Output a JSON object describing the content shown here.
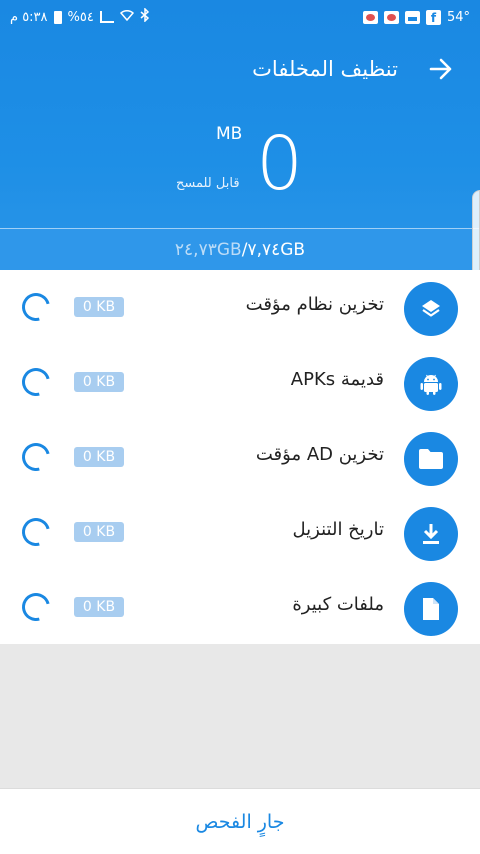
{
  "status_bar": {
    "time": "٥:٣٨ م",
    "battery_percent": "%٥٤",
    "temperature": "54°"
  },
  "header": {
    "title": "تنظيف المخلفات",
    "back_icon": "arrow-right-icon",
    "size_value": "0",
    "size_unit": "MB",
    "cleanable_label": "قابل للمسح"
  },
  "storage": {
    "used": "٢٤,٧٣GB",
    "separator": "/",
    "total": "٧,٧٤GB"
  },
  "items": [
    {
      "label": "تخزين نظام مؤقت",
      "size": "0 KB",
      "icon": "layers-icon"
    },
    {
      "label": "قديمة APKs",
      "size": "0 KB",
      "icon": "android-icon"
    },
    {
      "label": "تخزين AD مؤقت",
      "size": "0 KB",
      "icon": "folder-icon"
    },
    {
      "label": "تاريخ التنزيل",
      "size": "0 KB",
      "icon": "download-icon"
    },
    {
      "label": "ملفات كبيرة",
      "size": "0 KB",
      "icon": "file-icon"
    }
  ],
  "bottom": {
    "scan_label": "جارٍ الفحص"
  },
  "colors": {
    "accent": "#1a88e2",
    "badge": "#a8cdf0"
  }
}
